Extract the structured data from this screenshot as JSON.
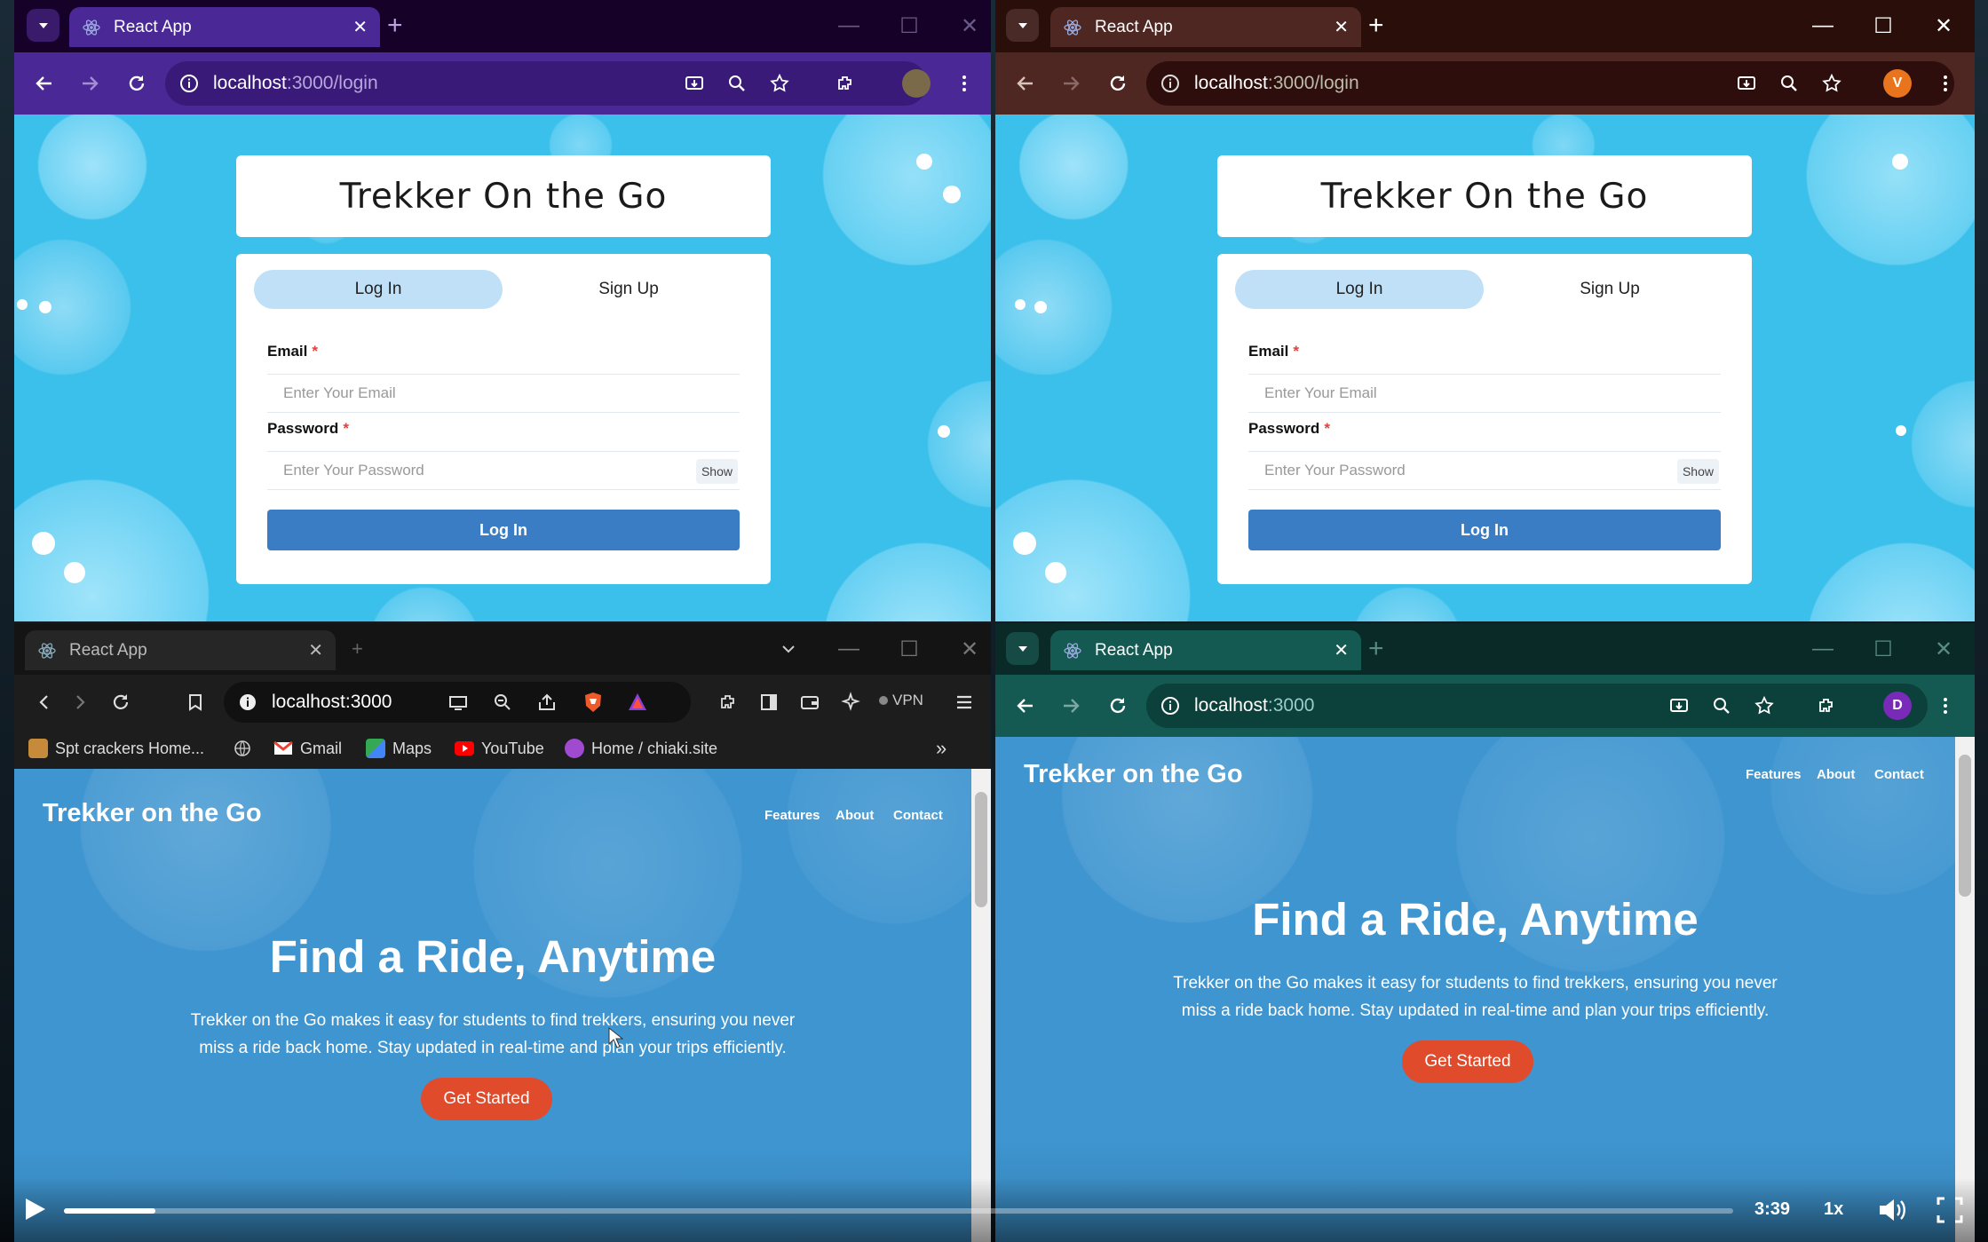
{
  "windows": {
    "top_left": {
      "tab_title": "React App",
      "url_host": "localhost",
      "url_path": ":3000/login"
    },
    "top_right": {
      "tab_title": "React App",
      "url_host": "localhost",
      "url_path": ":3000/login",
      "avatar_letter": "V"
    },
    "bottom_left": {
      "tab_title": "React App",
      "url": "localhost:3000",
      "vpn_label": "VPN",
      "bookmarks": [
        "Spt crackers Home...",
        "Gmail",
        "Maps",
        "YouTube",
        "Home / chiaki.site"
      ],
      "overflow": "»"
    },
    "bottom_right": {
      "tab_title": "React App",
      "url_host": "localhost",
      "url_path": ":3000",
      "avatar_letter": "D"
    }
  },
  "login": {
    "title": "Trekker On the Go",
    "tab_login": "Log In",
    "tab_signup": "Sign Up",
    "email_label": "Email",
    "password_label": "Password",
    "required_mark": "*",
    "email_placeholder": "Enter Your Email",
    "password_placeholder": "Enter Your Password",
    "show_label": "Show",
    "submit_label": "Log In"
  },
  "home": {
    "brand": "Trekker on the Go",
    "nav": [
      "Features",
      "About",
      "Contact"
    ],
    "hero_title": "Find a Ride, Anytime",
    "hero_line1": "Trekker on the Go makes it easy for students to find trekkers, ensuring you never",
    "hero_line2": "miss a ride back home. Stay updated in real-time and plan your trips efficiently.",
    "cta": "Get Started"
  },
  "player": {
    "time": "3:39",
    "speed": "1x",
    "progress": 0.055
  },
  "colors": {
    "win_tl": "#2a0a4a",
    "win_tr": "#3a1a16",
    "win_bl": "#1f1f1f",
    "win_br": "#0f3f3a",
    "login_bg": "#3ac0ea",
    "home_bg": "#3e95d0",
    "button_blue": "#3b7dc4",
    "cta_red": "#e04b2c"
  }
}
